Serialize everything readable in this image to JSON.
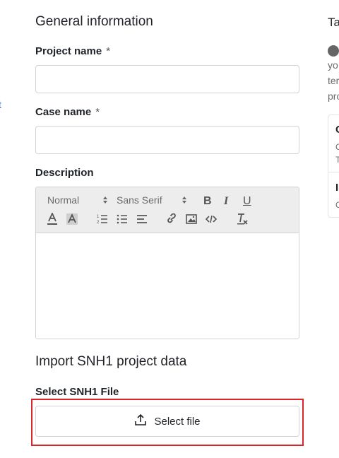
{
  "left_edge": {
    "link_fragment": "t"
  },
  "general": {
    "title": "General information",
    "project_name_label": "Project name",
    "case_name_label": "Case name",
    "required_mark": "*",
    "project_name_value": "",
    "case_name_value": "",
    "description_label": "Description"
  },
  "editor": {
    "header_select": "Normal",
    "font_select": "Sans Serif",
    "buttons": [
      "bold",
      "italic",
      "underline",
      "text-color",
      "background-color",
      "ordered-list",
      "bullet-list",
      "align",
      "link",
      "image",
      "code",
      "clear-format"
    ]
  },
  "import": {
    "title": "Import SNH1 project data",
    "file_label": "Select SNH1 File",
    "button_label": "Select file"
  },
  "right_panel": {
    "title_fragment": "Ta",
    "text_lines": [
      "yo",
      "ter",
      "pro"
    ],
    "card_items": [
      {
        "title": "C",
        "sub1": "C",
        "sub2": "T"
      },
      {
        "title": "I",
        "sub1": "C"
      }
    ]
  }
}
